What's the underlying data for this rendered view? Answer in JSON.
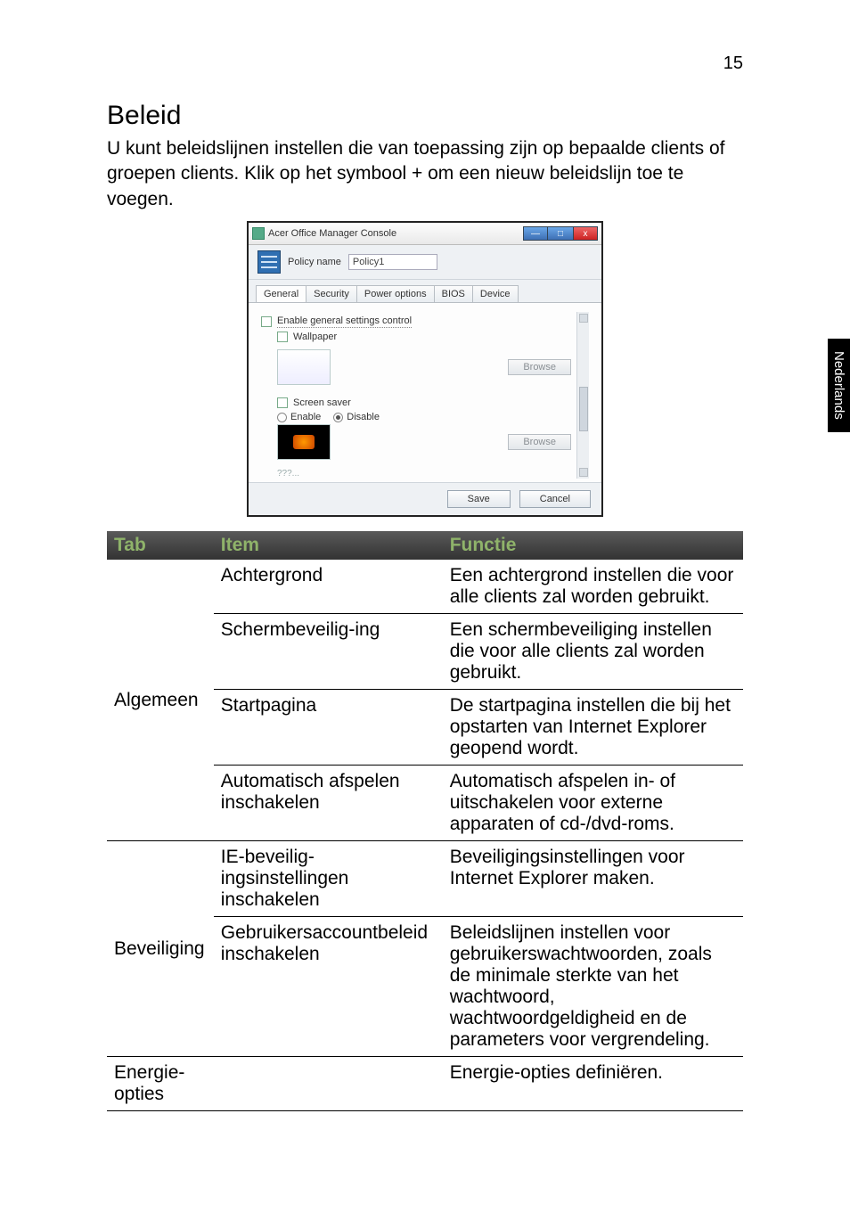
{
  "page_number": "15",
  "side_tab": "Nederlands",
  "heading": "Beleid",
  "intro": "U kunt beleidslijnen instellen die van toepassing zijn op bepaalde clients of groepen clients. Klik op het symbool + om een nieuw beleidslijn toe te voegen.",
  "screenshot": {
    "window_title": "Acer Office Manager Console",
    "policy_name_label": "Policy name",
    "policy_name_value": "Policy1",
    "tabs": [
      "General",
      "Security",
      "Power options",
      "BIOS",
      "Device"
    ],
    "enable_general_label": "Enable general settings control",
    "wallpaper_label": "Wallpaper",
    "screensaver_label": "Screen saver",
    "enable_label": "Enable",
    "disable_label": "Disable",
    "browse_label": "Browse",
    "truncated": "???...",
    "save_label": "Save",
    "cancel_label": "Cancel",
    "min_glyph": "—",
    "max_glyph": "□",
    "close_glyph": "x"
  },
  "table": {
    "headers": {
      "tab": "Tab",
      "item": "Item",
      "func": "Functie"
    },
    "rows": [
      {
        "tab": "Algemeen",
        "items": [
          {
            "item": "Achtergrond",
            "func": "Een achtergrond instellen die voor alle clients zal worden gebruikt."
          },
          {
            "item": "Schermbeveilig-ing",
            "func": "Een schermbeveiliging instellen die voor alle clients zal worden gebruikt."
          },
          {
            "item": "Startpagina",
            "func": "De startpagina instellen die bij het opstarten van Internet Explorer geopend wordt."
          },
          {
            "item": "Automatisch afspelen inschakelen",
            "func": "Automatisch afspelen in- of uitschakelen voor externe apparaten of cd-/dvd-roms."
          }
        ]
      },
      {
        "tab": "Beveiliging",
        "items": [
          {
            "item": "IE-beveilig-ingsinstellingen inschakelen",
            "func": "Beveiligingsinstellingen voor Internet Explorer maken."
          },
          {
            "item": "Gebruikersaccountbeleid inschakelen",
            "func": "Beleidslijnen instellen voor gebruikerswachtwoorden, zoals de minimale sterkte van het wachtwoord, wachtwoordgeldigheid en de parameters voor vergrendeling."
          }
        ]
      },
      {
        "tab": "Energie-opties",
        "items": [
          {
            "item": "",
            "func": "Energie-opties definiëren."
          }
        ]
      }
    ]
  }
}
